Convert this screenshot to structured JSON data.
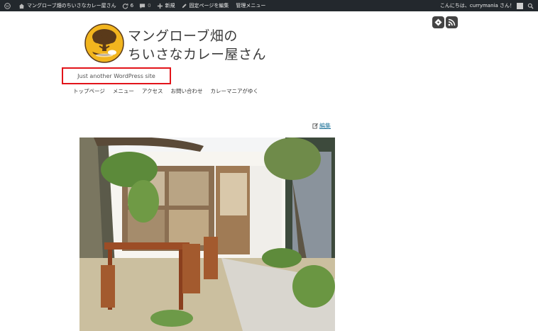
{
  "admin_bar": {
    "site_name": "マングローブ畑のちいさなカレー屋さん",
    "updates_count": "6",
    "comments_count": "0",
    "new_label": "新規",
    "edit_page_label": "固定ページを編集",
    "admin_menu_label": "管理メニュー",
    "greeting": "こんにちは、currymania さん！"
  },
  "header": {
    "title_line1": "マングローブ畑の",
    "title_line2": "ちいさなカレー屋さん",
    "tagline": "Just another WordPress site"
  },
  "nav": {
    "items": [
      "トップページ",
      "メニュー",
      "アクセス",
      "お問い合わせ",
      "カレーマニアがゆく"
    ]
  },
  "content": {
    "edit_label": "編集"
  },
  "colors": {
    "admin_bar_bg": "#23282d",
    "highlight_border": "#e2141a",
    "logo_yellow": "#f2b51e",
    "logo_brown": "#5a3a1a",
    "link_blue": "#21759b"
  },
  "icons": [
    "wordpress-icon",
    "home-icon",
    "updates-icon",
    "comment-icon",
    "plus-icon",
    "pencil-icon",
    "search-icon",
    "feedly-icon",
    "rss-icon"
  ]
}
